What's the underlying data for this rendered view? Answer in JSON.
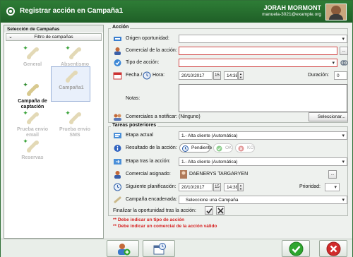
{
  "window": {
    "title": "Registrar acción en Campaña1"
  },
  "user": {
    "name": "JORAH MORMONT",
    "email": "manuela-3021@example.org"
  },
  "left_panel": {
    "header": "Selección de Campañas",
    "filter_label": "Filtro de campañas",
    "tiles": [
      {
        "label": "General",
        "state": "disabled"
      },
      {
        "label": "Absentismo",
        "state": "disabled"
      },
      {
        "label": "Campaña de captación",
        "state": "active"
      },
      {
        "label": "Campaña1",
        "state": "selected"
      },
      {
        "label": "Prueba envio email",
        "state": "disabled"
      },
      {
        "label": "Prueba envio SMS",
        "state": "disabled"
      },
      {
        "label": "Reservas",
        "state": "disabled"
      }
    ]
  },
  "accion": {
    "legend": "Acción",
    "origen_label": "Origen oportunidad:",
    "origen_value": "",
    "comercial_label": "Comercial de la acción:",
    "comercial_value": "",
    "tipo_label": "Tipo de acción:",
    "tipo_value": "",
    "fecha_label": "Fecha /",
    "hora_label": "Hora:",
    "fecha_value": "20/10/2017",
    "cal_day": "15",
    "hora_value": "14:38",
    "duracion_label": "Duración:",
    "duracion_value": "0",
    "notas_label": "Notas:",
    "notas_value": "",
    "comerciales_label": "Comerciales a notificar:",
    "comerciales_value": "(Ninguno)",
    "seleccionar_label": "Seleccionar..."
  },
  "tareas": {
    "legend": "Tareas posteriores",
    "etapa_actual_label": "Etapa actual",
    "etapa_actual_value": "1.- Alta cliente (Automática)",
    "resultado_label": "Resultado de la acción:",
    "pendiente_label": "Pendiente",
    "ok_label": "OK",
    "ko_label": "KO",
    "etapa_tras_label": "Etapa tras la acción:",
    "etapa_tras_value": "1.- Alta cliente (Automática)",
    "comercial_asignado_label": "Comercial asignado:",
    "comercial_asignado_value": "DAENERYS TARGARYEN",
    "siguiente_label": "Siguiente planificación:",
    "siguiente_fecha": "20/10/2017",
    "cal_day": "15",
    "siguiente_hora": "14:38",
    "prioridad_label": "Prioridad:",
    "prioridad_value": "",
    "encadenada_label": "Campaña encadenada:",
    "encadenada_value": "Seleccione una Campaña",
    "finalizar_label": "Finalizar la oportunidad tras la acción:"
  },
  "errors": [
    "** Debe indicar un tipo de acción",
    "** Debe indicar un comercial de la acción válido"
  ],
  "colors": {
    "titlebar": "#2e7d36",
    "error": "#d61f1f",
    "accept": "#2ea52e",
    "cancel": "#d12b2b"
  }
}
